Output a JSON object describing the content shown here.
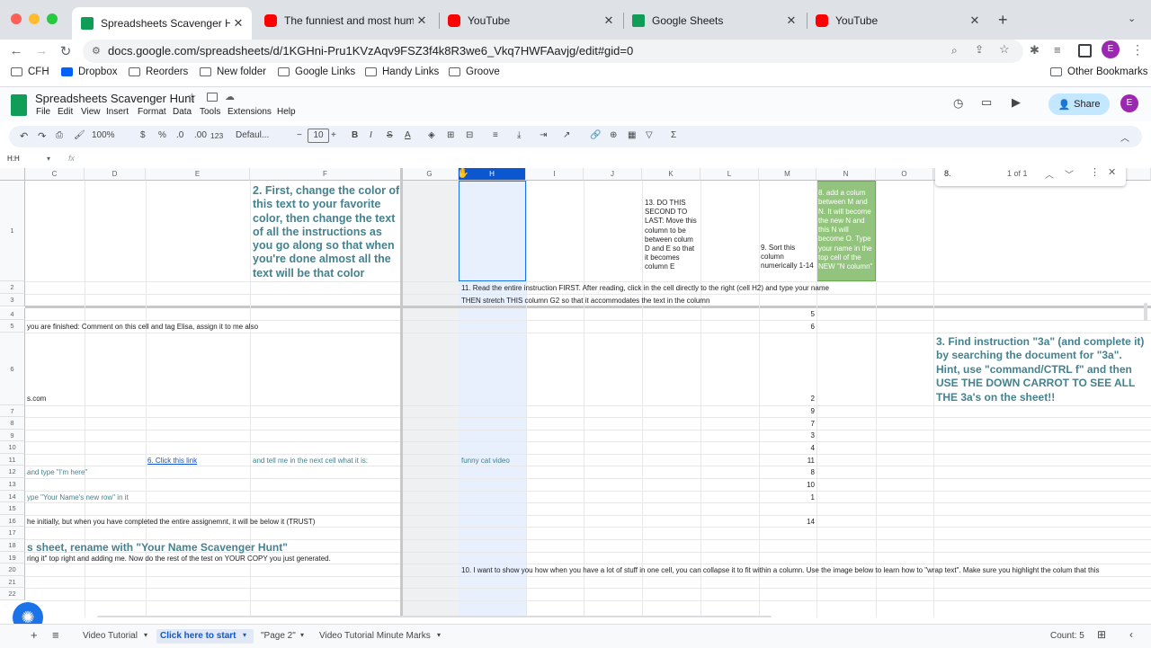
{
  "browser": {
    "tabs": [
      {
        "title": "Spreadsheets Scavenger Hunt",
        "icon": "sheets-icon",
        "active": true
      },
      {
        "title": "The funniest and most humoro",
        "icon": "youtube-icon",
        "active": false
      },
      {
        "title": "YouTube",
        "icon": "youtube-icon",
        "active": false
      },
      {
        "title": "Google Sheets",
        "icon": "sheets-icon",
        "active": false
      },
      {
        "title": "YouTube",
        "icon": "youtube-icon",
        "active": false
      }
    ],
    "new_tab": "+",
    "url": "docs.google.com/spreadsheets/d/1KGHni-Pru1KVzAqv9FSZ3f4k8R3we6_Vkq7HWFAavjg/edit#gid=0",
    "profile_initial": "E"
  },
  "bookmarks": {
    "items": [
      "CFH",
      "Dropbox",
      "Reorders",
      "New folder",
      "Google Links",
      "Handy Links",
      "Groove"
    ],
    "other": "Other Bookmarks"
  },
  "doc": {
    "title": "Spreadsheets Scavenger Hunt",
    "menus": [
      "File",
      "Edit",
      "View",
      "Insert",
      "Format",
      "Data",
      "Tools",
      "Extensions",
      "Help"
    ],
    "share_label": "Share",
    "avatar_initial": "E"
  },
  "toolbar": {
    "zoom": "100%",
    "currency": "$",
    "percent": "%",
    "dec_decrease": ".0",
    "dec_increase": ".00",
    "number_format": "123",
    "font": "Defaul...",
    "font_size": "10",
    "bold": "B",
    "italic": "I",
    "strike": "S",
    "text_color": "A",
    "sum": "Σ"
  },
  "formula_bar": {
    "cell_ref": "H:H",
    "fx": "fx"
  },
  "find": {
    "query": "8.",
    "count": "1 of 1"
  },
  "grid": {
    "columns": [
      "C",
      "D",
      "E",
      "F",
      "G",
      "H",
      "I",
      "J",
      "K",
      "L",
      "M",
      "N",
      "O"
    ],
    "rows": [
      "1",
      "2",
      "3",
      "4",
      "5",
      "6",
      "7",
      "8",
      "9",
      "10",
      "11",
      "12",
      "13",
      "14",
      "15",
      "16",
      "17",
      "18",
      "19",
      "20",
      "21",
      "22"
    ],
    "cells": {
      "f1": "2. First, change the color of this text to your favorite color, then change the text of all the instructions as you go along so that when you're done almost all the text will be that color",
      "k1": "13. DO THIS SECOND TO LAST: Move this column to be between colum D and E so that it becomes column E",
      "m1": "9. Sort this column numerically 1-14",
      "n1": "8. add a colum between M and N. It will become the new N and this N will become O. Type your name in the top cell of the NEW \"N column\"",
      "h2": "11. Read the entire instruction FIRST. After reading, click in the cell directly to the right (cell H2) and type your name",
      "h3": "THEN stretch THIS column G2 so that it accommodates the text in the column",
      "c5": "you are finished: Comment on this cell and tag Elisa, assign it to me also",
      "o6": "3. Find instruction \"3a\" (and complete it) by searching the document for \"3a\". Hint, use \"command/CTRL f\" and then USE THE DOWN CARROT TO SEE ALL THE 3a's on the sheet!!",
      "c6": "s.com",
      "e11": "6. Click this link",
      "f11": "and tell me in the next cell what it is:",
      "h11": "funny cat video",
      "c12": "and type \"I'm here\"",
      "c14": "ype \"Your Name's new row\" in it",
      "c16": "he initially, but when you have completed the entire assignemnt, it will be below it (TRUST)",
      "c18": "s sheet, rename with \"Your Name Scavenger Hunt\"",
      "c19": "ring it\" top right and adding me. Now do the rest of the test on YOUR COPY you just generated.",
      "h20": "10. I want to show you how when you have a lot of stuff in one cell, you can collapse it to fit within a column. Use the image below to learn how to \"wrap text\". Make sure you highlight the colum that this"
    },
    "m_values": {
      "4": "5",
      "5": "6",
      "6": "2",
      "7": "9",
      "8": "7",
      "9": "3",
      "10": "4",
      "11": "11",
      "12": "8",
      "13": "10",
      "14": "1",
      "16": "14"
    }
  },
  "sheet_tabs": [
    "Video Tutorial",
    "Click here to start",
    "\"Page 2\"",
    "Video Tutorial Minute Marks"
  ],
  "status": {
    "count": "Count: 5"
  },
  "colors": {
    "accent": "#0b57d0",
    "teal_text": "#45818e",
    "green_fill": "#93c47d",
    "selection": "#e8f0fe"
  }
}
